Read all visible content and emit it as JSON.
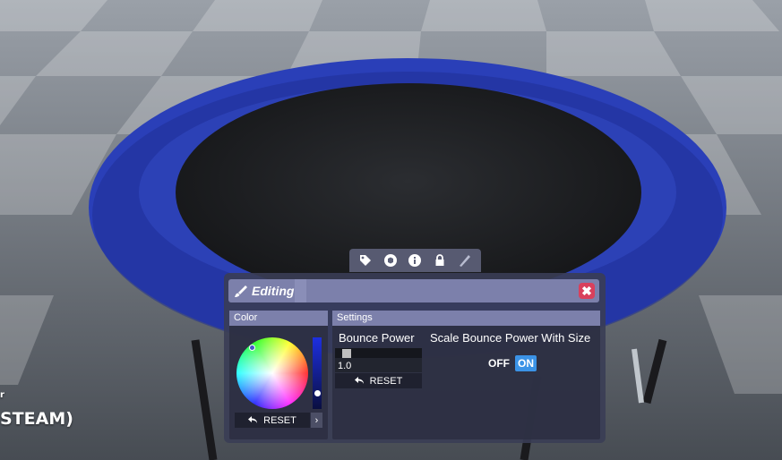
{
  "hud": {
    "small_text": "r",
    "partial_label": "STEAM)"
  },
  "toolbar": {
    "icons": [
      "tag-icon",
      "box-icon",
      "info-icon",
      "lock-icon",
      "pen-icon"
    ]
  },
  "window": {
    "title": "Editing",
    "close_icon": "✖"
  },
  "color_panel": {
    "header": "Color",
    "reset_label": "RESET",
    "expand_icon": "›",
    "selected_color": "#4657c8"
  },
  "settings_panel": {
    "header": "Settings",
    "bounce_power": {
      "label": "Bounce Power",
      "value": "1.0",
      "reset_label": "RESET"
    },
    "scale_bounce": {
      "label": "Scale Bounce Power With Size",
      "off_label": "OFF",
      "on_label": "ON",
      "state": "ON"
    }
  },
  "colors": {
    "accent": "#7c80ab",
    "toggle_on": "#3b93e6",
    "close": "#d9405c",
    "trampoline_pad": "#2a3fb8"
  }
}
